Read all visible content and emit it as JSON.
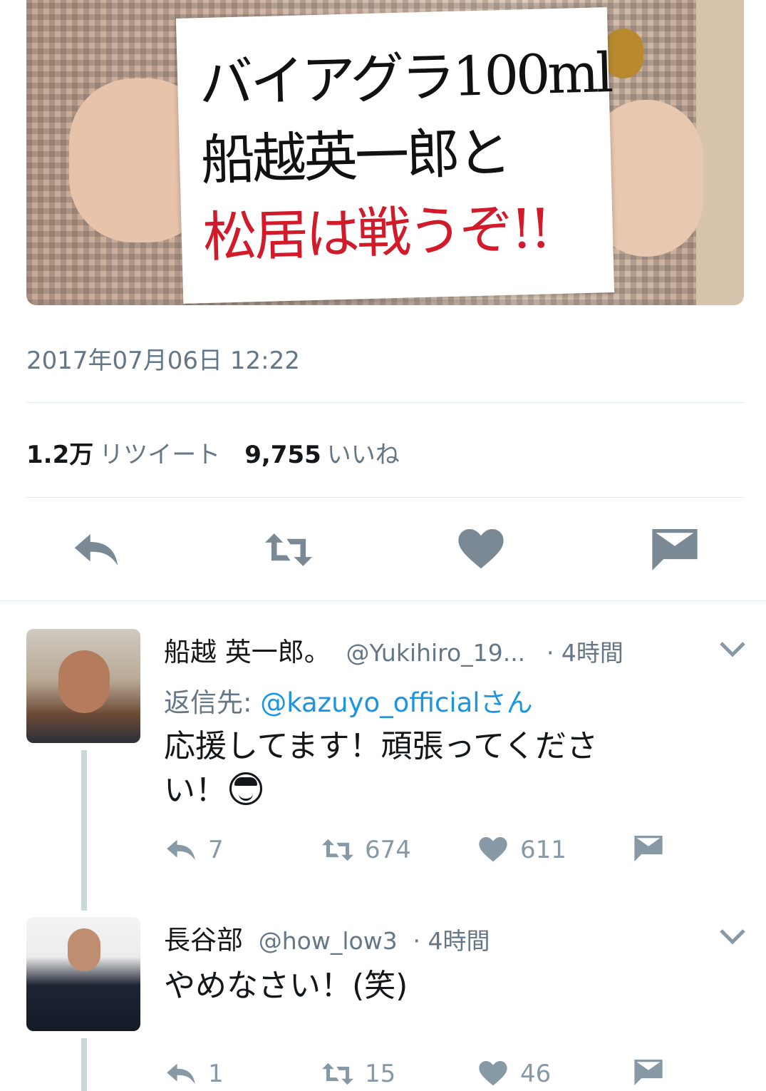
{
  "photo": {
    "sign_lines": [
      "バイアグラ100ml",
      "船越英一郎と",
      "松居は戦うぞ!!"
    ]
  },
  "tweet": {
    "timestamp": "2017年07月06日 12:22",
    "retweet_count": "1.2万",
    "retweet_label": "リツイート",
    "like_count": "9,755",
    "like_label": "いいね"
  },
  "actions": {
    "reply_icon": "reply-icon",
    "retweet_icon": "retweet-icon",
    "like_icon": "heart-icon",
    "dm_icon": "envelope-icon"
  },
  "replies": [
    {
      "name": "船越 英一郎。",
      "handle": "@Yukihiro_19...",
      "time": "· 4時間",
      "replying_prefix": "返信先:",
      "replying_link": "@kazuyo_official",
      "replying_suffix": "さん",
      "text_line1": "応援してます！頑張ってくださ",
      "text_line2": "い！",
      "reply_count": "7",
      "retweet_count": "674",
      "like_count": "611"
    },
    {
      "name": "長谷部",
      "handle": "@how_low3",
      "time": "· 4時間",
      "text_line1": "やめなさい！(笑)",
      "reply_count": "1",
      "retweet_count": "15",
      "like_count": "46"
    }
  ]
}
